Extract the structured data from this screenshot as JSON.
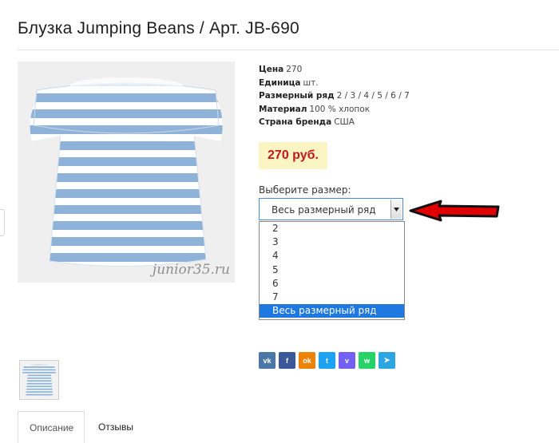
{
  "product": {
    "title": "Блузка Jumping Beans / Арт. JB-690",
    "watermark": "junior35.ru"
  },
  "specs": [
    {
      "label": "Цена",
      "value": "270"
    },
    {
      "label": "Единица",
      "value": "шт."
    },
    {
      "label": "Размерный ряд",
      "value": "2 / 3 / 4 / 5 / 6 / 7"
    },
    {
      "label": "Материал",
      "value": "100 % хлопок"
    },
    {
      "label": "Страна бренда",
      "value": "США"
    }
  ],
  "price": "270 руб.",
  "size_select": {
    "label": "Выберите размер:",
    "value": "Весь размерный ряд",
    "options": [
      "2",
      "3",
      "4",
      "5",
      "6",
      "7",
      "Весь размерный ряд"
    ],
    "selected_index": 6
  },
  "social": [
    {
      "icon": "vk-icon",
      "glyph": "vk",
      "color": "#4a76a8"
    },
    {
      "icon": "facebook-icon",
      "glyph": "f",
      "color": "#3b5998"
    },
    {
      "icon": "odnoklassniki-icon",
      "glyph": "ok",
      "color": "#ee8208"
    },
    {
      "icon": "twitter-icon",
      "glyph": "t",
      "color": "#1da1f2"
    },
    {
      "icon": "viber-icon",
      "glyph": "v",
      "color": "#7360f2"
    },
    {
      "icon": "whatsapp-icon",
      "glyph": "w",
      "color": "#25d366"
    },
    {
      "icon": "telegram-icon",
      "glyph": "➤",
      "color": "#2ca5e0"
    }
  ],
  "tabs": [
    {
      "label": "Описание",
      "active": true
    },
    {
      "label": "Отзывы",
      "active": false
    }
  ],
  "colors": {
    "price_bg": "#fbf4c3",
    "price_text": "#c5171a",
    "arrow": "#e00000",
    "selected_option": "#1e78e0"
  }
}
